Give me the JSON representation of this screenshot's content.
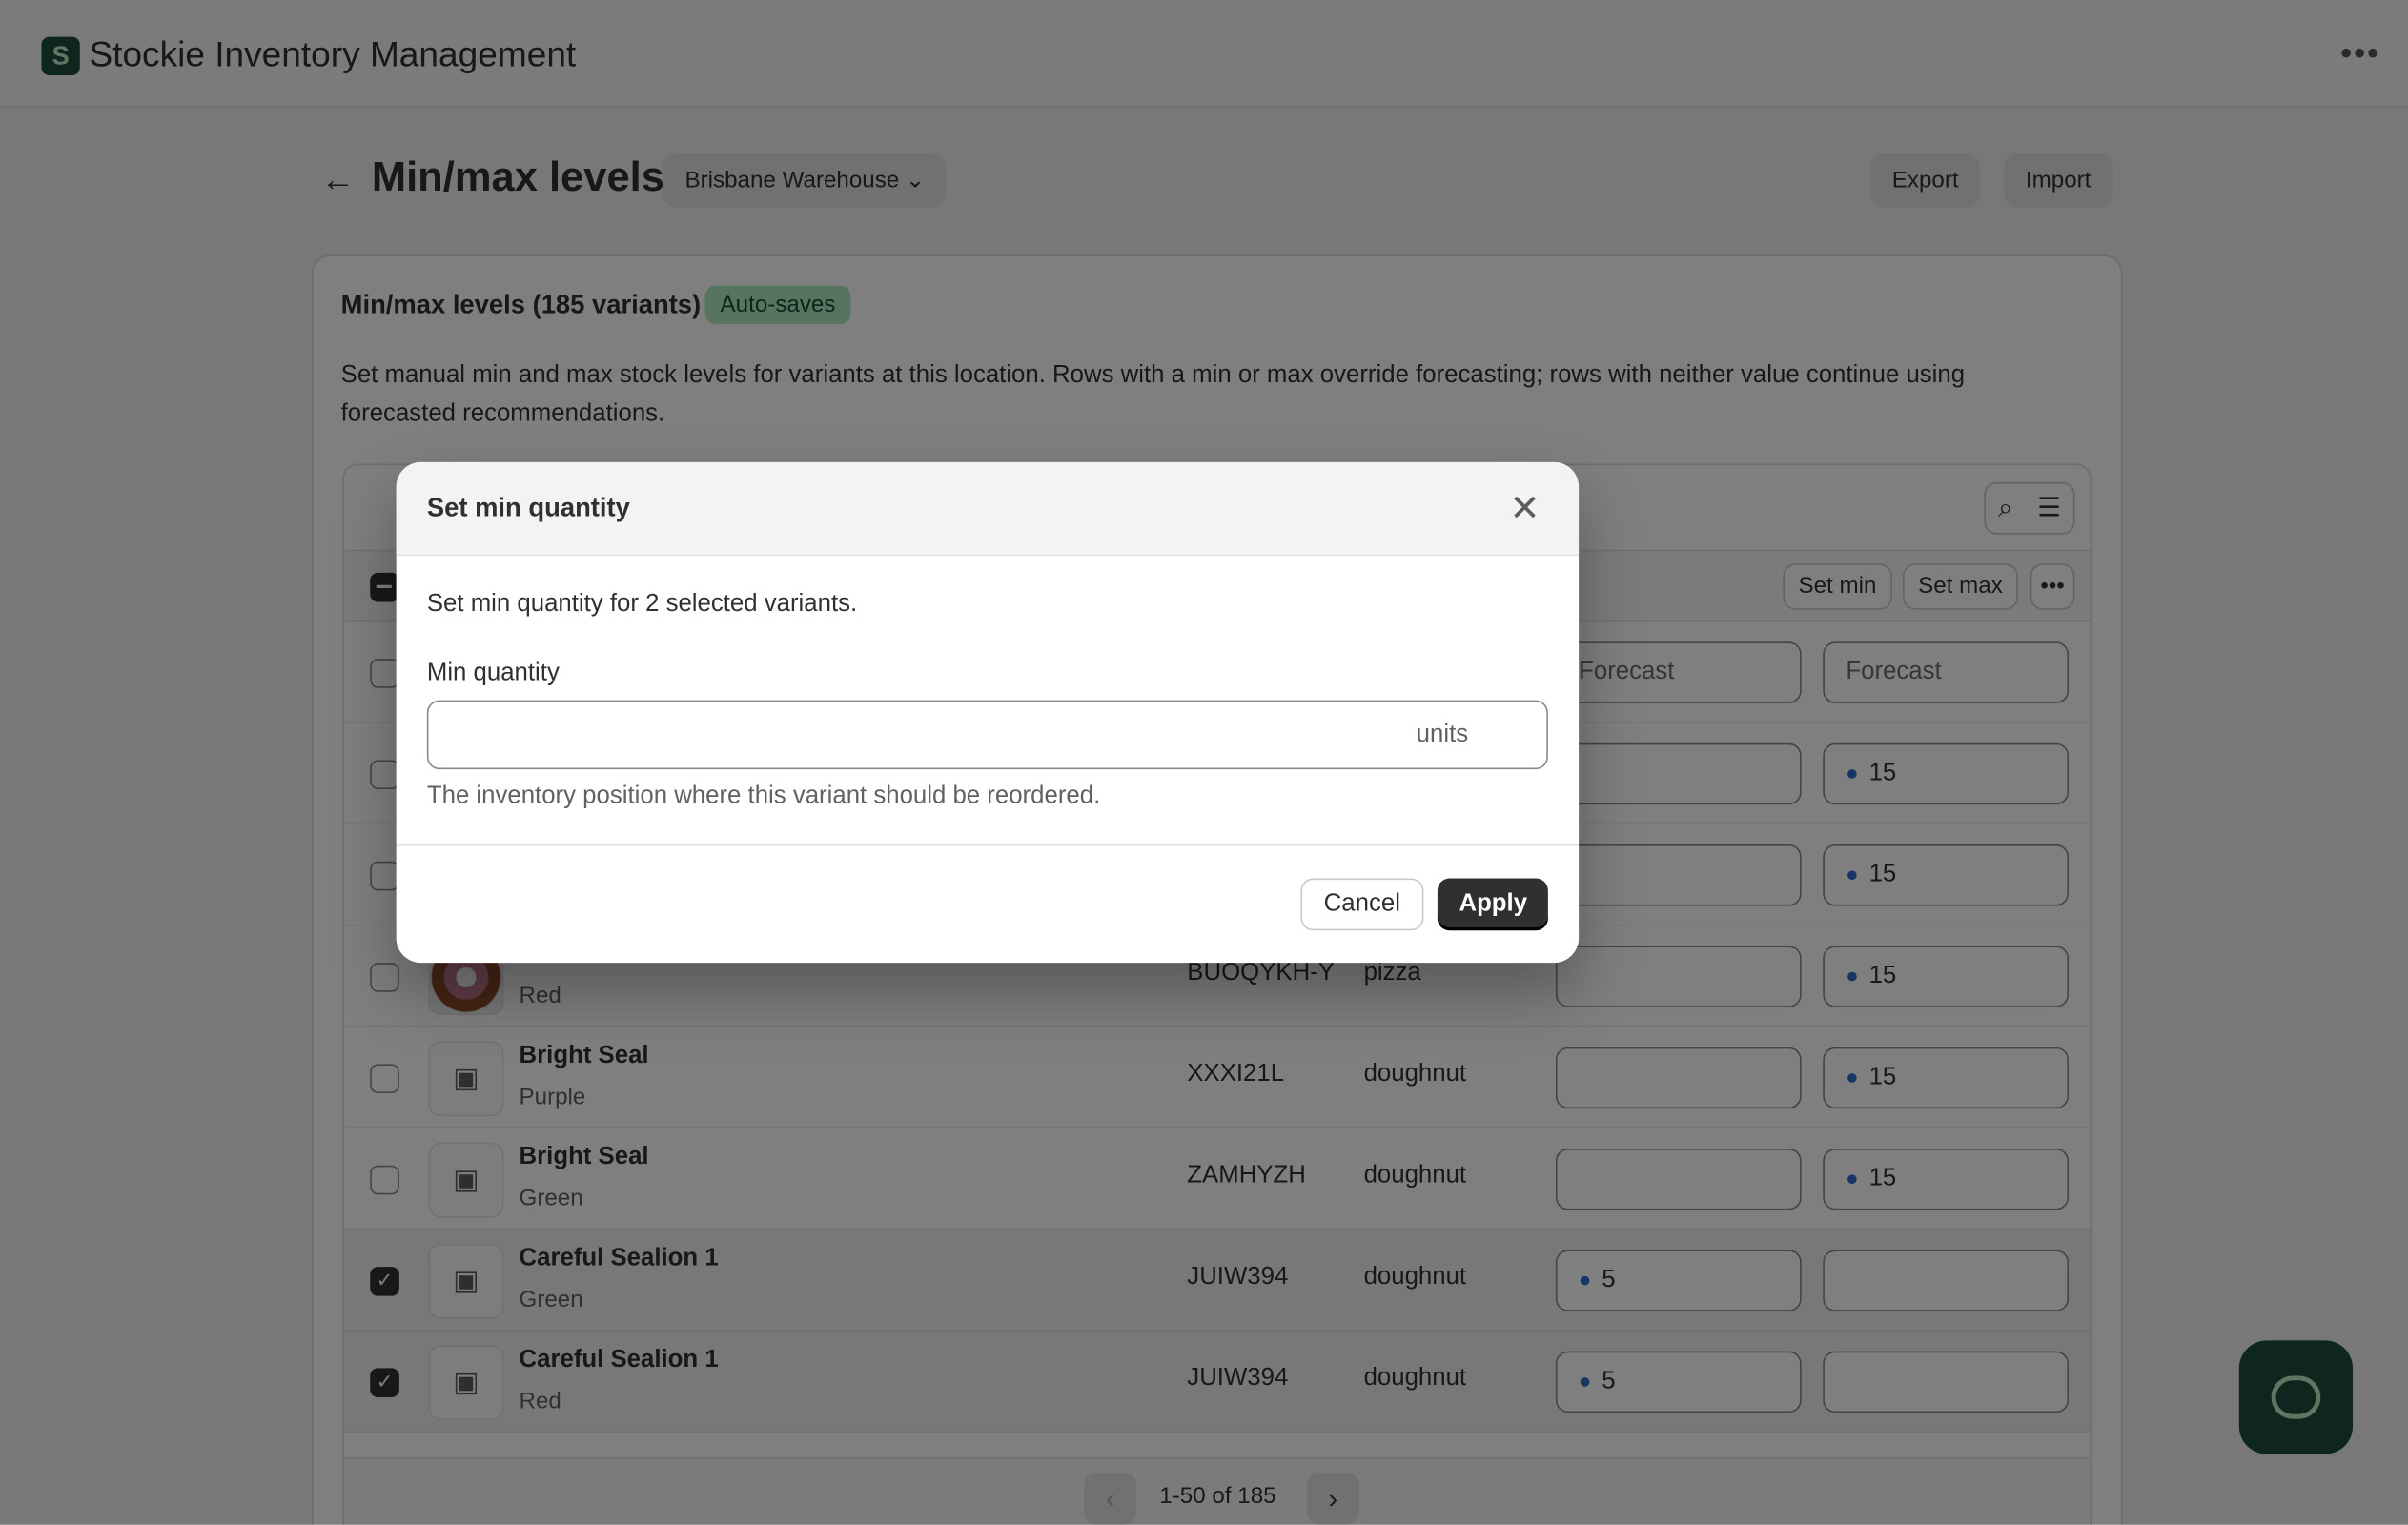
{
  "app": {
    "title": "Stockie Inventory Management",
    "logo_letter": "S",
    "menu_icon": "more-horizontal-icon"
  },
  "header": {
    "title": "Min/max levels",
    "location": "Brisbane Warehouse",
    "export_label": "Export",
    "import_label": "Import"
  },
  "card": {
    "title": "Min/max levels (185 variants)",
    "badge": "Auto-saves",
    "description": "Set manual min and max stock levels for variants at this location. Rows with a min or max override forecasting; rows with neither value continue using forecasted recommendations."
  },
  "bulk": {
    "set_min": "Set min",
    "set_max": "Set max"
  },
  "header_row": {
    "min_placeholder": "Forecast",
    "max_placeholder": "Forecast"
  },
  "rows": [
    {
      "name": "",
      "variant": "",
      "sku": "",
      "type": "",
      "min": "",
      "max": "15",
      "checked": false
    },
    {
      "name": "",
      "variant": "",
      "sku": "",
      "type": "",
      "min": "",
      "max": "15",
      "checked": false
    },
    {
      "name": "",
      "variant": "Red",
      "sku": "BUOQYKH-Y",
      "type": "pizza",
      "min": "",
      "max": "15",
      "checked": false
    },
    {
      "name": "Bright Seal",
      "variant": "Purple",
      "sku": "XXXI21L",
      "type": "doughnut",
      "min": "",
      "max": "15",
      "checked": false
    },
    {
      "name": "Bright Seal",
      "variant": "Green",
      "sku": "ZAMHYZH",
      "type": "doughnut",
      "min": "",
      "max": "15",
      "checked": false
    },
    {
      "name": "Careful Sealion 1",
      "variant": "Green",
      "sku": "JUIW394",
      "type": "doughnut",
      "min": "5",
      "max": "",
      "checked": true
    },
    {
      "name": "Careful Sealion 1",
      "variant": "Red",
      "sku": "JUIW394",
      "type": "doughnut",
      "min": "5",
      "max": "",
      "checked": true
    }
  ],
  "pagination": {
    "label": "1-50 of 185"
  },
  "modal": {
    "title": "Set min quantity",
    "intro": "Set min quantity for 2 selected variants.",
    "field_label": "Min quantity",
    "field_value": "",
    "suffix": "units",
    "help": "The inventory position where this variant should be reordered.",
    "cancel_label": "Cancel",
    "apply_label": "Apply"
  }
}
